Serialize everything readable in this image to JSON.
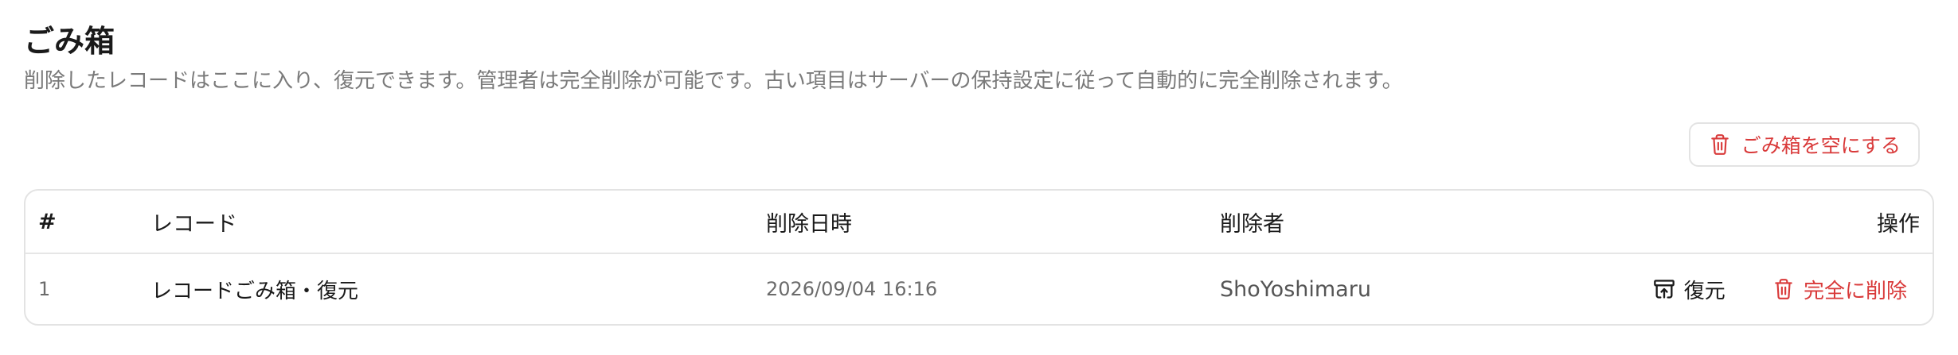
{
  "page": {
    "title": "ごみ箱",
    "description": "削除したレコードはここに入り、復元できます。管理者は完全削除が可能です。古い項目はサーバーの保持設定に従って自動的に完全削除されます。"
  },
  "toolbar": {
    "empty_label": "ごみ箱を空にする",
    "empty_icon": "trash-icon"
  },
  "table": {
    "headers": [
      "#",
      "レコード",
      "削除日時",
      "削除者",
      "操作"
    ],
    "rows": [
      {
        "num": "1",
        "record": "レコードごみ箱・復元",
        "deleted_at": "2026/09/04 16:16",
        "deleted_by": "ShoYoshimaru",
        "restore_label": "復元",
        "delete_label": "完全に削除"
      }
    ]
  },
  "colors": {
    "danger": "#d93a3a",
    "border": "#e3e3e3",
    "muted": "#7a7a7a"
  }
}
